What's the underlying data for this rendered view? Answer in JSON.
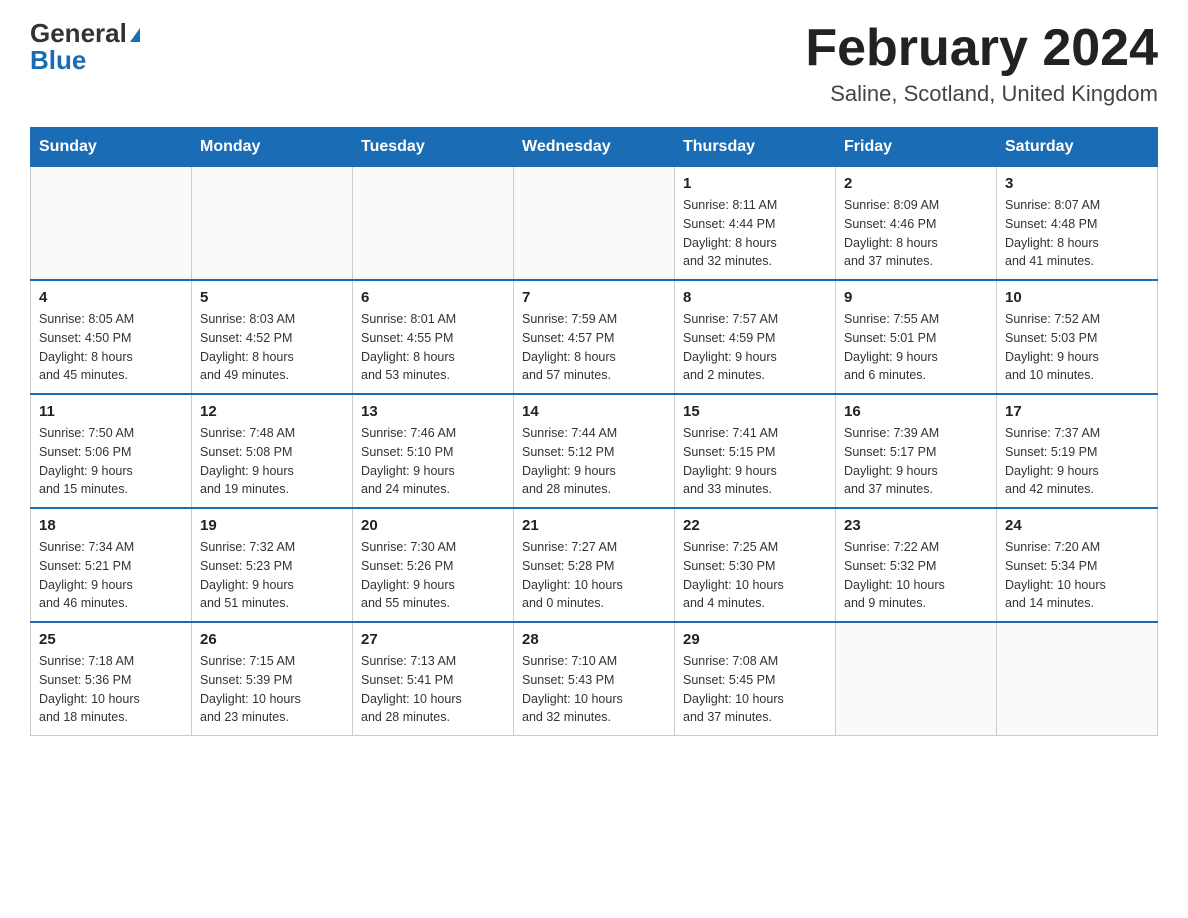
{
  "header": {
    "logo_general": "General",
    "logo_blue": "Blue",
    "month_title": "February 2024",
    "location": "Saline, Scotland, United Kingdom"
  },
  "days_of_week": [
    "Sunday",
    "Monday",
    "Tuesday",
    "Wednesday",
    "Thursday",
    "Friday",
    "Saturday"
  ],
  "weeks": [
    {
      "days": [
        {
          "number": "",
          "info": ""
        },
        {
          "number": "",
          "info": ""
        },
        {
          "number": "",
          "info": ""
        },
        {
          "number": "",
          "info": ""
        },
        {
          "number": "1",
          "info": "Sunrise: 8:11 AM\nSunset: 4:44 PM\nDaylight: 8 hours\nand 32 minutes."
        },
        {
          "number": "2",
          "info": "Sunrise: 8:09 AM\nSunset: 4:46 PM\nDaylight: 8 hours\nand 37 minutes."
        },
        {
          "number": "3",
          "info": "Sunrise: 8:07 AM\nSunset: 4:48 PM\nDaylight: 8 hours\nand 41 minutes."
        }
      ]
    },
    {
      "days": [
        {
          "number": "4",
          "info": "Sunrise: 8:05 AM\nSunset: 4:50 PM\nDaylight: 8 hours\nand 45 minutes."
        },
        {
          "number": "5",
          "info": "Sunrise: 8:03 AM\nSunset: 4:52 PM\nDaylight: 8 hours\nand 49 minutes."
        },
        {
          "number": "6",
          "info": "Sunrise: 8:01 AM\nSunset: 4:55 PM\nDaylight: 8 hours\nand 53 minutes."
        },
        {
          "number": "7",
          "info": "Sunrise: 7:59 AM\nSunset: 4:57 PM\nDaylight: 8 hours\nand 57 minutes."
        },
        {
          "number": "8",
          "info": "Sunrise: 7:57 AM\nSunset: 4:59 PM\nDaylight: 9 hours\nand 2 minutes."
        },
        {
          "number": "9",
          "info": "Sunrise: 7:55 AM\nSunset: 5:01 PM\nDaylight: 9 hours\nand 6 minutes."
        },
        {
          "number": "10",
          "info": "Sunrise: 7:52 AM\nSunset: 5:03 PM\nDaylight: 9 hours\nand 10 minutes."
        }
      ]
    },
    {
      "days": [
        {
          "number": "11",
          "info": "Sunrise: 7:50 AM\nSunset: 5:06 PM\nDaylight: 9 hours\nand 15 minutes."
        },
        {
          "number": "12",
          "info": "Sunrise: 7:48 AM\nSunset: 5:08 PM\nDaylight: 9 hours\nand 19 minutes."
        },
        {
          "number": "13",
          "info": "Sunrise: 7:46 AM\nSunset: 5:10 PM\nDaylight: 9 hours\nand 24 minutes."
        },
        {
          "number": "14",
          "info": "Sunrise: 7:44 AM\nSunset: 5:12 PM\nDaylight: 9 hours\nand 28 minutes."
        },
        {
          "number": "15",
          "info": "Sunrise: 7:41 AM\nSunset: 5:15 PM\nDaylight: 9 hours\nand 33 minutes."
        },
        {
          "number": "16",
          "info": "Sunrise: 7:39 AM\nSunset: 5:17 PM\nDaylight: 9 hours\nand 37 minutes."
        },
        {
          "number": "17",
          "info": "Sunrise: 7:37 AM\nSunset: 5:19 PM\nDaylight: 9 hours\nand 42 minutes."
        }
      ]
    },
    {
      "days": [
        {
          "number": "18",
          "info": "Sunrise: 7:34 AM\nSunset: 5:21 PM\nDaylight: 9 hours\nand 46 minutes."
        },
        {
          "number": "19",
          "info": "Sunrise: 7:32 AM\nSunset: 5:23 PM\nDaylight: 9 hours\nand 51 minutes."
        },
        {
          "number": "20",
          "info": "Sunrise: 7:30 AM\nSunset: 5:26 PM\nDaylight: 9 hours\nand 55 minutes."
        },
        {
          "number": "21",
          "info": "Sunrise: 7:27 AM\nSunset: 5:28 PM\nDaylight: 10 hours\nand 0 minutes."
        },
        {
          "number": "22",
          "info": "Sunrise: 7:25 AM\nSunset: 5:30 PM\nDaylight: 10 hours\nand 4 minutes."
        },
        {
          "number": "23",
          "info": "Sunrise: 7:22 AM\nSunset: 5:32 PM\nDaylight: 10 hours\nand 9 minutes."
        },
        {
          "number": "24",
          "info": "Sunrise: 7:20 AM\nSunset: 5:34 PM\nDaylight: 10 hours\nand 14 minutes."
        }
      ]
    },
    {
      "days": [
        {
          "number": "25",
          "info": "Sunrise: 7:18 AM\nSunset: 5:36 PM\nDaylight: 10 hours\nand 18 minutes."
        },
        {
          "number": "26",
          "info": "Sunrise: 7:15 AM\nSunset: 5:39 PM\nDaylight: 10 hours\nand 23 minutes."
        },
        {
          "number": "27",
          "info": "Sunrise: 7:13 AM\nSunset: 5:41 PM\nDaylight: 10 hours\nand 28 minutes."
        },
        {
          "number": "28",
          "info": "Sunrise: 7:10 AM\nSunset: 5:43 PM\nDaylight: 10 hours\nand 32 minutes."
        },
        {
          "number": "29",
          "info": "Sunrise: 7:08 AM\nSunset: 5:45 PM\nDaylight: 10 hours\nand 37 minutes."
        },
        {
          "number": "",
          "info": ""
        },
        {
          "number": "",
          "info": ""
        }
      ]
    }
  ]
}
